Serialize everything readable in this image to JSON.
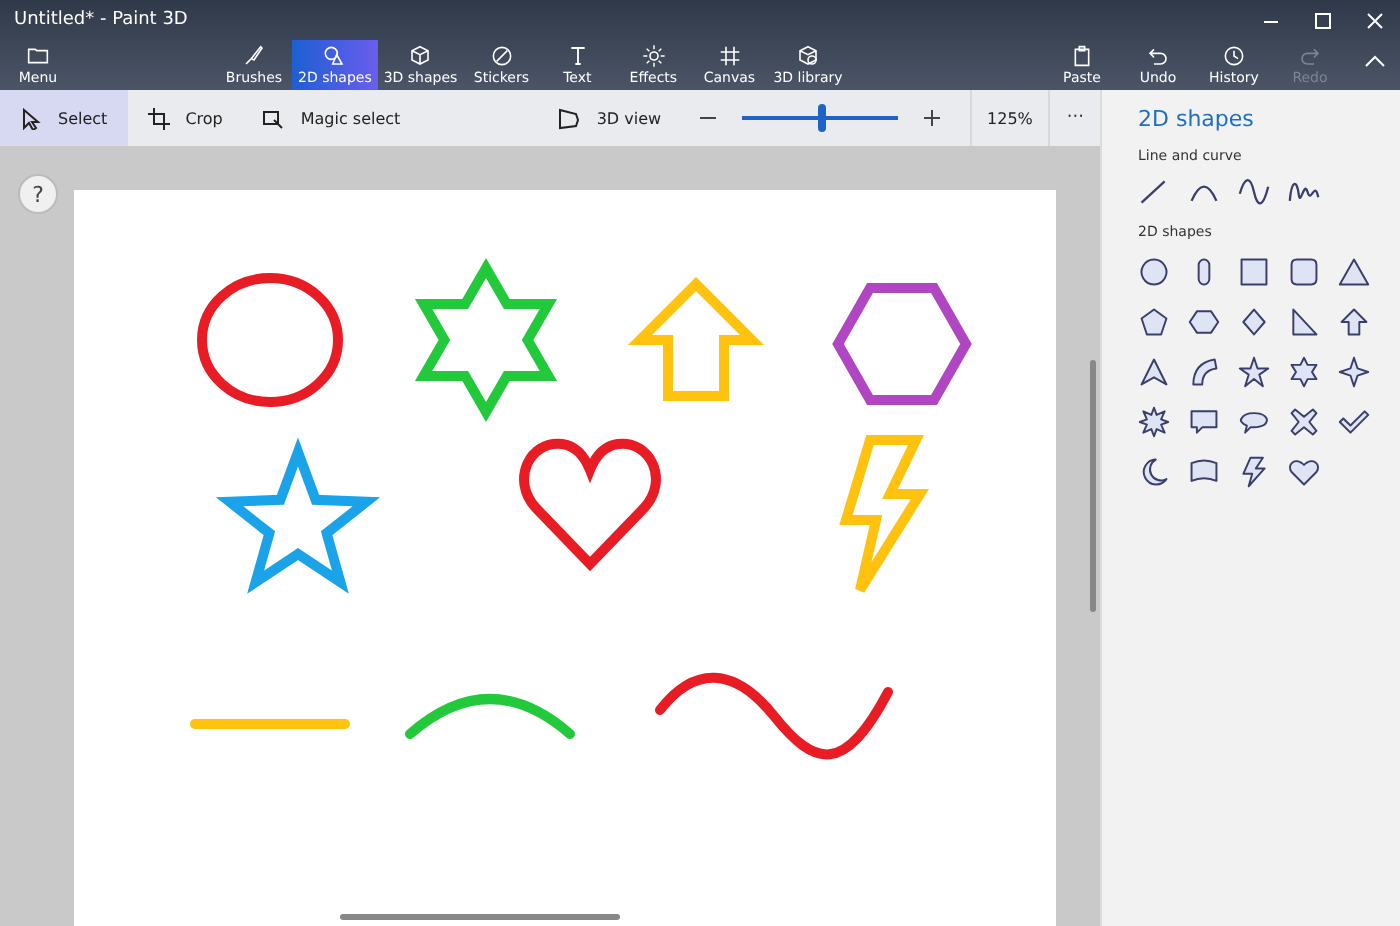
{
  "window": {
    "title": "Untitled* - Paint 3D"
  },
  "toolbar": {
    "menu": "Menu",
    "tabs": [
      {
        "label": "Brushes",
        "selected": false
      },
      {
        "label": "2D shapes",
        "selected": true
      },
      {
        "label": "3D shapes",
        "selected": false
      },
      {
        "label": "Stickers",
        "selected": false
      },
      {
        "label": "Text",
        "selected": false
      },
      {
        "label": "Effects",
        "selected": false
      },
      {
        "label": "Canvas",
        "selected": false
      },
      {
        "label": "3D library",
        "selected": false
      }
    ],
    "actions": [
      {
        "label": "Paste",
        "disabled": false
      },
      {
        "label": "Undo",
        "disabled": false
      },
      {
        "label": "History",
        "disabled": false
      },
      {
        "label": "Redo",
        "disabled": true
      }
    ]
  },
  "options_bar": {
    "tools": [
      {
        "label": "Select",
        "selected": true
      },
      {
        "label": "Crop",
        "selected": false
      },
      {
        "label": "Magic select",
        "selected": false
      }
    ],
    "view_3d": "3D view",
    "zoom": {
      "level": 0.52,
      "reading": "125%"
    },
    "more": "···"
  },
  "help": "?",
  "canvas": {
    "shapes": [
      {
        "kind": "ellipse",
        "color": "#e81c24"
      },
      {
        "kind": "six-point-star",
        "color": "#22c93a"
      },
      {
        "kind": "arrow-up",
        "color": "#ffc20e"
      },
      {
        "kind": "hexagon",
        "color": "#b146c2"
      },
      {
        "kind": "star",
        "color": "#1aa3e8"
      },
      {
        "kind": "heart",
        "color": "#e81c24"
      },
      {
        "kind": "lightning",
        "color": "#ffc20e"
      },
      {
        "kind": "line",
        "color": "#ffc20e"
      },
      {
        "kind": "arc",
        "color": "#22c93a"
      },
      {
        "kind": "wave",
        "color": "#e81c24"
      }
    ]
  },
  "panel": {
    "title": "2D shapes",
    "sections": [
      {
        "heading": "Line and curve"
      },
      {
        "heading": "2D shapes"
      }
    ]
  }
}
